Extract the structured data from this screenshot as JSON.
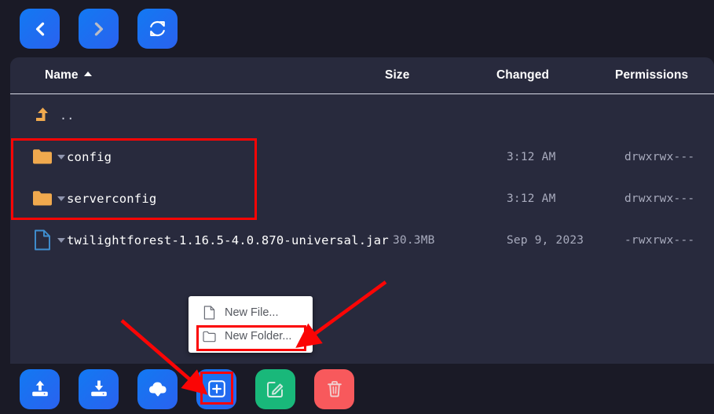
{
  "colors": {
    "panel_bg": "#282a3d",
    "page_bg": "#1a1a26",
    "accent_blue": "#1279f2",
    "accent_green": "#19b87a",
    "accent_red": "#f8595c",
    "annotation_red": "#fb0505",
    "folder_orange": "#f0a94e",
    "file_blue": "#3f8fd1"
  },
  "top_toolbar": {
    "buttons": [
      {
        "name": "back",
        "icon": "chevron-left-icon",
        "state": "enabled"
      },
      {
        "name": "forward",
        "icon": "chevron-right-icon",
        "state": "disabled"
      },
      {
        "name": "refresh",
        "icon": "refresh-icon",
        "state": "enabled"
      }
    ]
  },
  "file_table": {
    "columns": [
      {
        "key": "name",
        "label": "Name",
        "sorted": "asc"
      },
      {
        "key": "size",
        "label": "Size"
      },
      {
        "key": "changed",
        "label": "Changed"
      },
      {
        "key": "permissions",
        "label": "Permissions"
      }
    ],
    "rows": [
      {
        "icon": "level-up-icon",
        "name": "..",
        "size": "",
        "changed": "",
        "permissions": "",
        "type": "parent"
      },
      {
        "icon": "folder-icon",
        "name": "config",
        "size": "",
        "changed": "3:12 AM",
        "permissions": "drwxrwx---",
        "type": "folder"
      },
      {
        "icon": "folder-icon",
        "name": "serverconfig",
        "size": "",
        "changed": "3:12 AM",
        "permissions": "drwxrwx---",
        "type": "folder"
      },
      {
        "icon": "file-icon",
        "name": "twilightforest-1.16.5-4.0.870-universal.jar",
        "size": "30.3MB",
        "changed": "Sep 9, 2023",
        "permissions": "-rwxrwx---",
        "type": "file"
      }
    ]
  },
  "context_menu": {
    "items": [
      {
        "label": "New File...",
        "icon": "file-icon",
        "highlighted": false
      },
      {
        "label": "New Folder...",
        "icon": "folder-outline-icon",
        "highlighted": true
      }
    ]
  },
  "bottom_toolbar": {
    "buttons": [
      {
        "name": "upload",
        "icon": "upload-icon",
        "color": "blue"
      },
      {
        "name": "download",
        "icon": "download-icon",
        "color": "blue"
      },
      {
        "name": "download-from-url",
        "icon": "cloud-download-icon",
        "color": "blue"
      },
      {
        "name": "new",
        "icon": "plus-square-icon",
        "color": "blue",
        "highlighted": true
      },
      {
        "name": "edit",
        "icon": "edit-square-icon",
        "color": "green"
      },
      {
        "name": "delete",
        "icon": "trash-icon",
        "color": "red"
      }
    ]
  },
  "annotations": {
    "boxes": [
      {
        "name": "folder-rows-highlight",
        "target": "config and serverconfig rows"
      },
      {
        "name": "new-folder-menu-highlight",
        "target": "New Folder... menu item"
      },
      {
        "name": "new-button-highlight",
        "target": "new button"
      }
    ],
    "arrows": [
      {
        "name": "arrow-to-new-button",
        "from": "context menu area",
        "to": "new button"
      },
      {
        "name": "arrow-to-new-folder",
        "from": "right side",
        "to": "New Folder... menu item"
      }
    ]
  }
}
